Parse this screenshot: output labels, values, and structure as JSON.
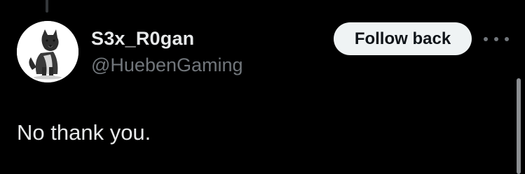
{
  "user": {
    "display_name": "S3x_R0gan",
    "handle": "@HuebenGaming"
  },
  "actions": {
    "follow_label": "Follow back",
    "more_icon": "ellipsis-icon"
  },
  "tweet": {
    "text": "No thank you."
  },
  "colors": {
    "background": "#000000",
    "primary_text": "#e7e9ea",
    "secondary_text": "#71767b",
    "button_bg": "#eff3f4",
    "button_text": "#0f1419"
  }
}
